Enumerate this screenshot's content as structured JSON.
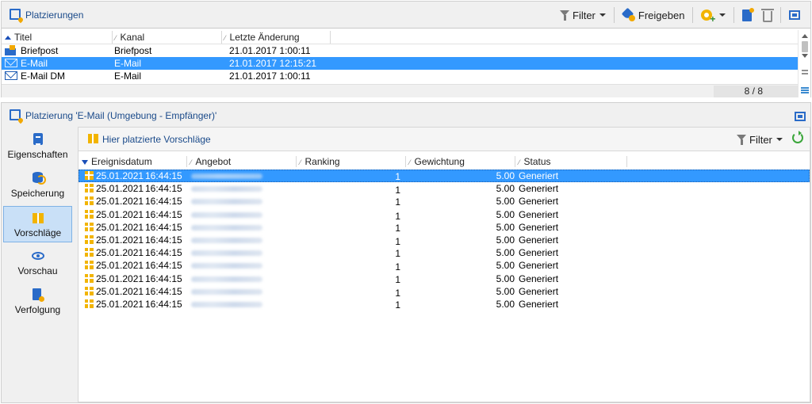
{
  "top_panel": {
    "title": "Platzierungen",
    "toolbar": {
      "filter_label": "Filter",
      "share_label": "Freigeben"
    },
    "columns": [
      "Titel",
      "Kanal",
      "Letzte Änderung"
    ],
    "rows": [
      {
        "title": "Briefpost",
        "channel": "Briefpost",
        "modified": "21.01.2017 1:00:11",
        "icon": "mail-post-icon",
        "selected": false
      },
      {
        "title": "E-Mail",
        "channel": "E-Mail",
        "modified": "21.01.2017 12:15:21",
        "icon": "envelope-icon",
        "selected": true
      },
      {
        "title": "E-Mail DM",
        "channel": "E-Mail",
        "modified": "21.01.2017 1:00:11",
        "icon": "envelope-icon",
        "selected": false
      }
    ],
    "count": "8 / 8"
  },
  "detail_panel": {
    "title": "Platzierung 'E-Mail (Umgebung - Empfänger)'",
    "nav": [
      {
        "label": "Eigenschaften",
        "icon": "clipboard-icon",
        "active": false
      },
      {
        "label": "Speicherung",
        "icon": "database-icon",
        "active": false
      },
      {
        "label": "Vorschläge",
        "icon": "gift-icon",
        "active": true
      },
      {
        "label": "Vorschau",
        "icon": "eye-icon",
        "active": false
      },
      {
        "label": "Verfolgung",
        "icon": "tracking-icon",
        "active": false
      }
    ],
    "content_title": "Hier platzierte Vorschläge",
    "filter_label": "Filter",
    "columns": [
      "Ereignisdatum",
      "Angebot",
      "Ranking",
      "Gewichtung",
      "Status"
    ],
    "rows": [
      {
        "date": "25.01.2021",
        "time": "16:44:15",
        "ranking": "1",
        "weight": "5.00",
        "status": "Generiert",
        "selected": true
      },
      {
        "date": "25.01.2021",
        "time": "16:44:15",
        "ranking": "1",
        "weight": "5.00",
        "status": "Generiert",
        "selected": false
      },
      {
        "date": "25.01.2021",
        "time": "16:44:15",
        "ranking": "1",
        "weight": "5.00",
        "status": "Generiert",
        "selected": false
      },
      {
        "date": "25.01.2021",
        "time": "16:44:15",
        "ranking": "1",
        "weight": "5.00",
        "status": "Generiert",
        "selected": false
      },
      {
        "date": "25.01.2021",
        "time": "16:44:15",
        "ranking": "1",
        "weight": "5.00",
        "status": "Generiert",
        "selected": false
      },
      {
        "date": "25.01.2021",
        "time": "16:44:15",
        "ranking": "1",
        "weight": "5.00",
        "status": "Generiert",
        "selected": false
      },
      {
        "date": "25.01.2021",
        "time": "16:44:15",
        "ranking": "1",
        "weight": "5.00",
        "status": "Generiert",
        "selected": false
      },
      {
        "date": "25.01.2021",
        "time": "16:44:15",
        "ranking": "1",
        "weight": "5.00",
        "status": "Generiert",
        "selected": false
      },
      {
        "date": "25.01.2021",
        "time": "16:44:15",
        "ranking": "1",
        "weight": "5.00",
        "status": "Generiert",
        "selected": false
      },
      {
        "date": "25.01.2021",
        "time": "16:44:15",
        "ranking": "1",
        "weight": "5.00",
        "status": "Generiert",
        "selected": false
      },
      {
        "date": "25.01.2021",
        "time": "16:44:15",
        "ranking": "1",
        "weight": "5.00",
        "status": "Generiert",
        "selected": false
      }
    ]
  },
  "colors": {
    "selection": "#3399ff",
    "accent": "#2a6bc8",
    "title_text": "#1a4a8a",
    "gift": "#f2b400"
  }
}
